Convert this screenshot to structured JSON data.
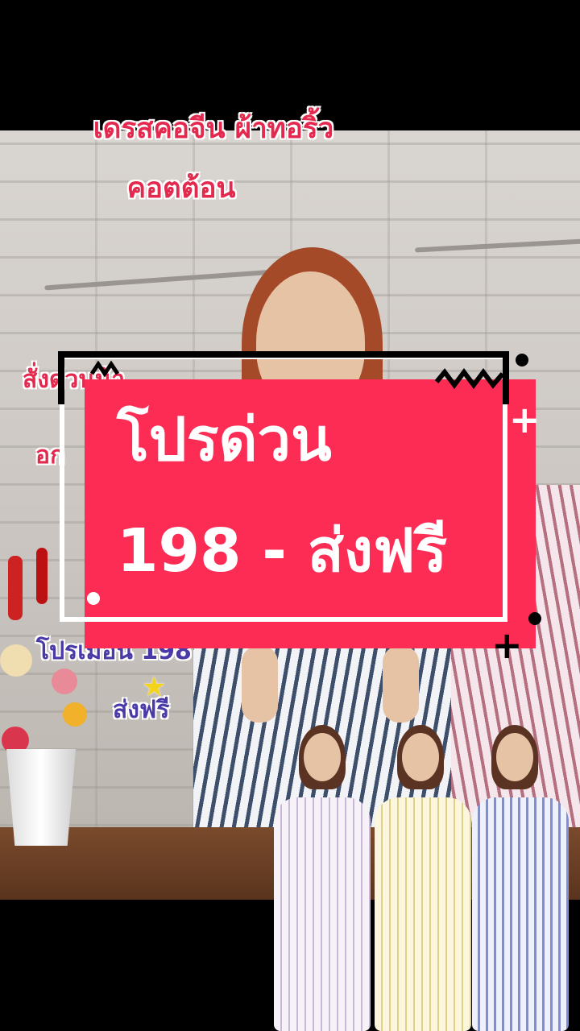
{
  "video": {
    "title_line1": "เดรสคอจีน ผ้าทอริ้ว",
    "title_line2": "คอตต้อน",
    "side_text_1": "สั่งด่วนน้า",
    "side_text_2": "อก",
    "promo_under_1": "โปรเมื่อน 198",
    "promo_under_2": "ส่งฟรี"
  },
  "banner": {
    "line1": "โปรด่วน",
    "line2": "198 - ส่งฟรี",
    "background_color": "#fc2c54",
    "text_color": "#ffffff"
  },
  "icons": {
    "sparkle": "star-icon",
    "zigzag": "zigzag-icon",
    "plus": "plus-icon"
  }
}
